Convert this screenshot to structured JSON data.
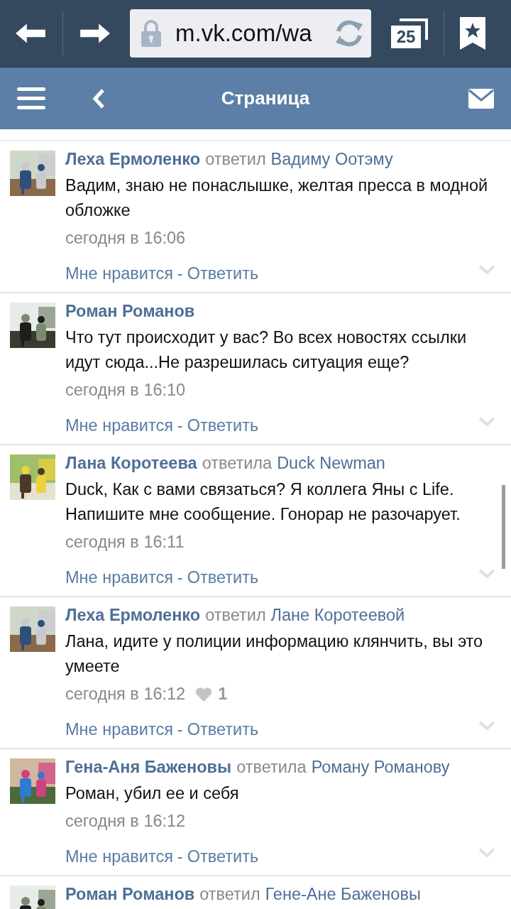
{
  "browser": {
    "url": "m.vk.com/wa",
    "tab_count": "25"
  },
  "app_bar": {
    "title": "Страница"
  },
  "comments": [
    {
      "author": "Леха Ермоленко",
      "verb": "ответил",
      "recipient": "Вадиму Оотэму",
      "text": "Вадим, знаю не понаслышке, желтая пресса в модной обложке",
      "time": "сегодня в 16:06",
      "actions": {
        "like": "Мне нравится",
        "separator": "-",
        "reply": "Ответить"
      }
    },
    {
      "author": "Роман Романов",
      "text": "Что тут происходит у вас? Во всех новостях ссылки идут сюда...Не разрешилась ситуация еще?",
      "time": "сегодня в 16:10",
      "actions": {
        "like": "Мне нравится",
        "separator": "-",
        "reply": "Ответить"
      }
    },
    {
      "author": "Лана Коротеева",
      "verb": "ответила",
      "recipient": "Duck Newman",
      "text": "Duck, Как с вами связаться? Я коллега Яны с Life. Напишите мне сообщение. Гонорар не разочарует.",
      "time": "сегодня в 16:11",
      "actions": {
        "like": "Мне нравится",
        "separator": "-",
        "reply": "Ответить"
      }
    },
    {
      "author": "Леха Ермоленко",
      "verb": "ответил",
      "recipient": "Лане Коротеевой",
      "text": "Лана, идите у полиции информацию клянчить, вы это умеете",
      "time": "сегодня в 16:12",
      "likes": "1",
      "actions": {
        "like": "Мне нравится",
        "separator": "-",
        "reply": "Ответить"
      }
    },
    {
      "author": "Гена-Аня Баженовы",
      "verb": "ответила",
      "recipient": "Роману Романову",
      "text": "Роман, убил ее и себя",
      "time": "сегодня в 16:12",
      "actions": {
        "like": "Мне нравится",
        "separator": "-",
        "reply": "Ответить"
      }
    },
    {
      "author": "Роман Романов",
      "verb": "ответил",
      "recipient": "Гене-Ане Баженовы"
    }
  ]
}
